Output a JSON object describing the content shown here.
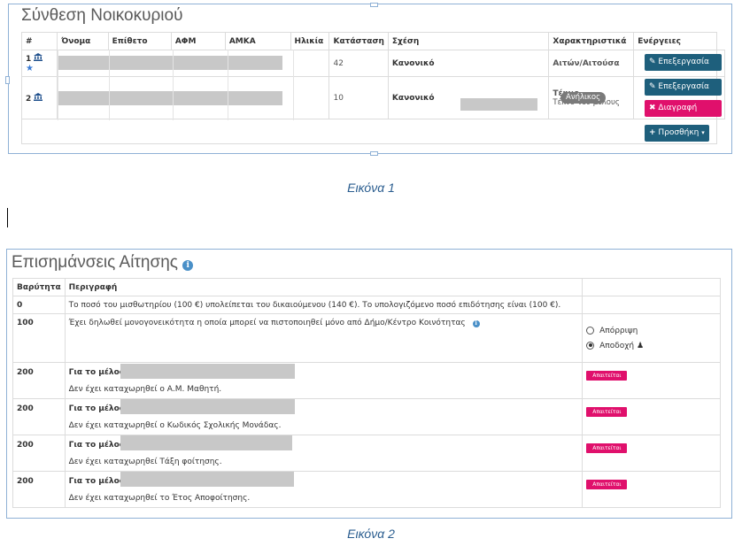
{
  "household": {
    "title": "Σύνθεση Νοικοκυριού",
    "headers": [
      "#",
      "Όνομα",
      "Επίθετο",
      "ΑΦΜ",
      "ΑΜΚΑ",
      "Ηλικία",
      "Κατάσταση",
      "Σχέση",
      "Χαρακτηριστικά",
      "Ενέργειες"
    ],
    "rows": [
      {
        "num": "1",
        "age": "42",
        "status": "Κανονικό",
        "relation": "Αιτών/Αιτούσα",
        "relation_sub": "",
        "badge": ""
      },
      {
        "num": "2",
        "age": "10",
        "status": "Κανονικό",
        "relation": "Τέκνο",
        "relation_sub": "Τέκνο του μέλους",
        "badge": "Ανήλικος"
      }
    ],
    "edit_label": "Επεξεργασία",
    "delete_label": "Διαγραφή",
    "add_label": "Προσθήκη"
  },
  "caption1": "Εικόνα 1",
  "remarks": {
    "title": "Επισημάνσεις Αίτησης",
    "headers": [
      "Βαρύτητα",
      "Περιγραφή",
      ""
    ],
    "rows": [
      {
        "weight": "0",
        "desc": "Το ποσό του μισθωτηρίου (100 €) υπολείπεται του δικαιούμενου (140 €). Το υπολογιζόμενο ποσό επιδότησης είναι (100 €)."
      },
      {
        "weight": "100",
        "desc": "Έχει δηλωθεί μονογονεικότητα η οποία μπορεί να πιστοποιηθεί μόνο από Δήμο/Κέντρο Κοινότητας"
      },
      {
        "weight": "200",
        "member": "Για το μέλος",
        "desc": "Δεν έχει καταχωρηθεί ο Α.Μ. Μαθητή."
      },
      {
        "weight": "200",
        "member": "Για το μέλος",
        "desc": "Δεν έχει καταχωρηθεί ο Κωδικός Σχολικής Μονάδας."
      },
      {
        "weight": "200",
        "member": "Για το μέλος",
        "desc": "Δεν έχει καταχωρηθεί Τάξη φοίτησης."
      },
      {
        "weight": "200",
        "member": "Για το μέλος",
        "desc": "Δεν έχει καταχωρηθεί το Έτος Αποφοίτησης."
      }
    ],
    "reject_label": "Απόρριψη",
    "accept_label": "Αποδοχή",
    "required_label": "Απαιτείται"
  },
  "caption2": "Εικόνα 2"
}
